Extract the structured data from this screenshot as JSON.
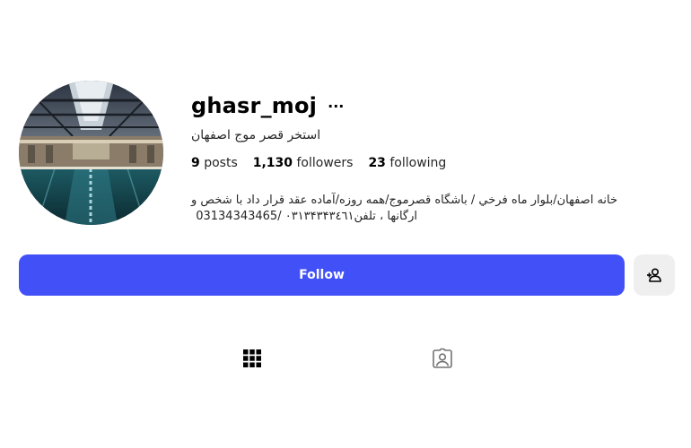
{
  "profile": {
    "username": "ghasr_moj",
    "more_label": "···",
    "full_name": "استخر قصر موج اصفهان",
    "stats": [
      {
        "count": "9",
        "label": "posts"
      },
      {
        "count": "1,130",
        "label": "followers"
      },
      {
        "count": "23",
        "label": "following"
      }
    ],
    "bio_line1": "خانه اصفهان/بلوار ماه فرخي / باشگاه قصرموج/همه روزه/آماده عقد قرار داد با شخص و",
    "bio_line2": "ارگانها ، تلفن۰۳۱۳۴۳۴۳٤٦۱ /03134343465"
  },
  "actions": {
    "follow_label": "Follow"
  },
  "icons": {
    "more": "more-horizontal-icon",
    "suggest": "add-person-icon",
    "posts_tab": "grid-icon",
    "tagged_tab": "tagged-person-icon"
  },
  "colors": {
    "follow_button": "#4150f7",
    "secondary_button": "#efefef"
  }
}
